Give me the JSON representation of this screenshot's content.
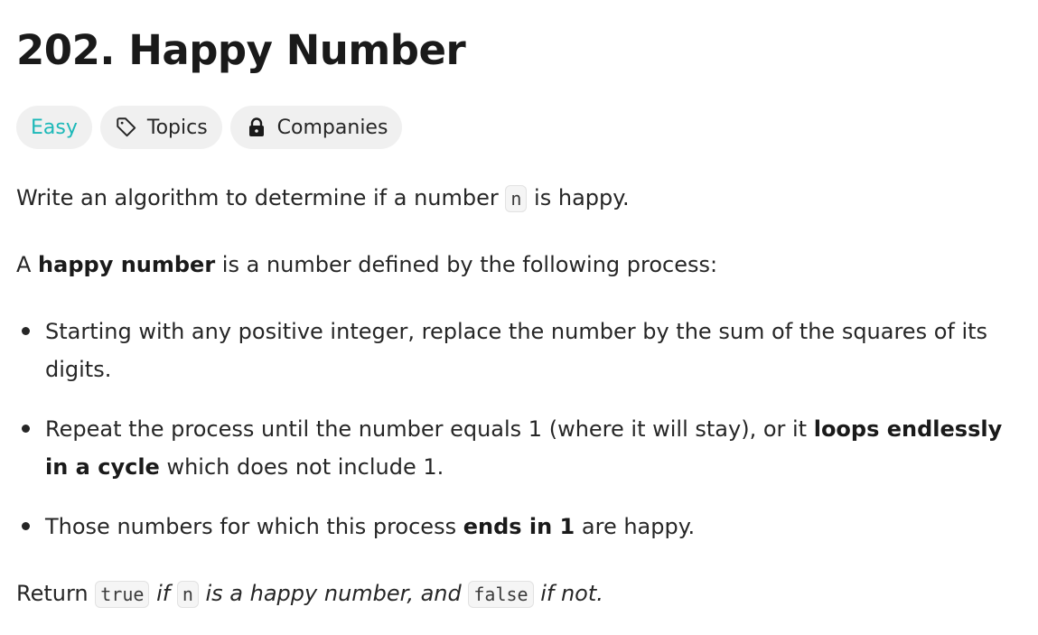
{
  "problem": {
    "title": "202. Happy Number"
  },
  "tags": {
    "difficulty": "Easy",
    "topics": "Topics",
    "companies": "Companies"
  },
  "description": {
    "p1": {
      "before": "Write an algorithm to determine if a number ",
      "code": "n",
      "after": " is happy."
    },
    "p2": {
      "before": "A ",
      "bold": "happy number",
      "after": " is a number defined by the following process:"
    },
    "bullets": [
      {
        "text": "Starting with any positive integer, replace the number by the sum of the squares of its digits."
      },
      {
        "before": "Repeat the process until the number equals 1 (where it will stay), or it ",
        "bold": "loops endlessly in a cycle",
        "after": " which does not include 1."
      },
      {
        "before": "Those numbers for which this process ",
        "bold": "ends in 1",
        "after": " are happy."
      }
    ],
    "p3": {
      "before": "Return ",
      "code1": "true",
      "mid1": " if ",
      "code2": "n",
      "mid2": " is a happy number, and ",
      "code3": "false",
      "after": " if not."
    }
  },
  "colors": {
    "easy": "#1cb8b8",
    "text": "#262626",
    "tag_bg": "#f0f0f0"
  }
}
